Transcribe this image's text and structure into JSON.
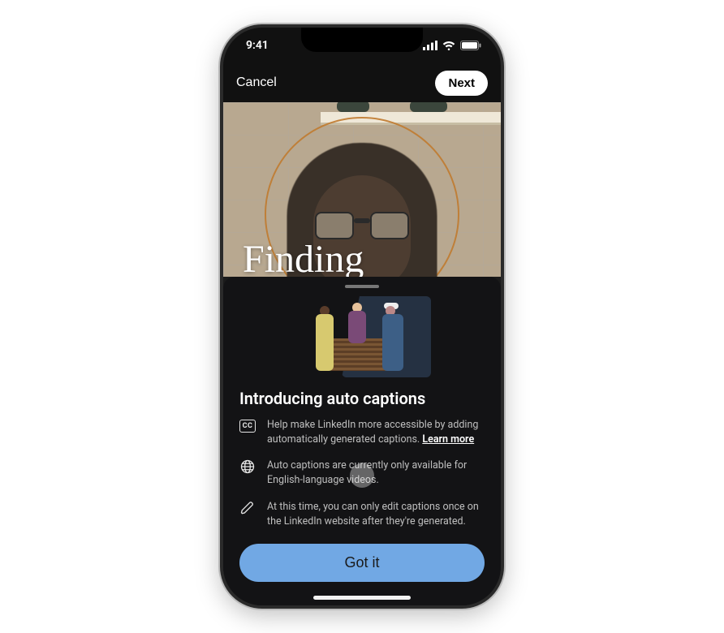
{
  "status": {
    "time": "9:41"
  },
  "nav": {
    "cancel_label": "Cancel",
    "next_label": "Next"
  },
  "video": {
    "overlay_text": "Finding"
  },
  "sheet": {
    "title": "Introducing auto captions",
    "features": [
      {
        "icon": "cc-icon",
        "text": "Help make LinkedIn more accessible by adding automatically generated captions.",
        "learn_more": "Learn more"
      },
      {
        "icon": "globe-icon",
        "text": "Auto captions are currently only available for English-language videos."
      },
      {
        "icon": "pencil-icon",
        "text": "At this time, you can only edit captions once on the LinkedIn website after they're generated."
      }
    ],
    "button_label": "Got it",
    "cc_badge_text": "CC"
  }
}
